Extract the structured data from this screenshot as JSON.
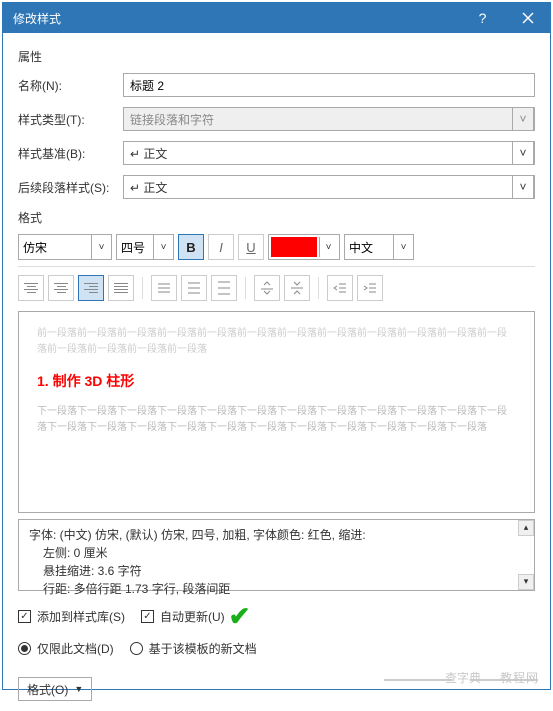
{
  "titlebar": {
    "title": "修改样式"
  },
  "properties": {
    "section_label": "属性",
    "name_label": "名称(N):",
    "name_value": "标题 2",
    "type_label": "样式类型(T):",
    "type_value": "链接段落和字符",
    "based_label": "样式基准(B):",
    "based_value": "↵ 正文",
    "next_label": "后续段落样式(S):",
    "next_value": "↵ 正文"
  },
  "format": {
    "section_label": "格式",
    "font_name": "仿宋",
    "font_size": "四号",
    "bold": "B",
    "italic": "I",
    "underline": "U",
    "color": "#fe0000",
    "lang": "中文"
  },
  "preview": {
    "before": "前一段落前一段落前一段落前一段落前一段落前一段落前一段落前一段落前一段落前一段落前一段落前一段落前一段落前一段落前一段落前一段落",
    "main": "1. 制作 3D 柱形",
    "after": "下一段落下一段落下一段落下一段落下一段落下一段落下一段落下一段落下一段落下一段落下一段落下一段落下一段落下一段落下一段落下一段落下一段落下一段落下一段落下一段落下一段落下一段落下一段落"
  },
  "description": {
    "line1": "字体: (中文) 仿宋, (默认) 仿宋, 四号, 加粗, 字体颜色: 红色, 缩进:",
    "line2": "左侧:  0 厘米",
    "line3": "悬挂缩进: 3.6 字符",
    "line4": "行距: 多倍行距 1.73 字行, 段落间距"
  },
  "options": {
    "add_to_lib": "添加到样式库(S)",
    "auto_update": "自动更新(U)",
    "only_this_doc": "仅限此文档(D)",
    "based_on_template": "基于该模板的新文档"
  },
  "buttons": {
    "format": "格式(O)"
  },
  "watermark": {
    "left": "查字典",
    "right": "教程网"
  }
}
